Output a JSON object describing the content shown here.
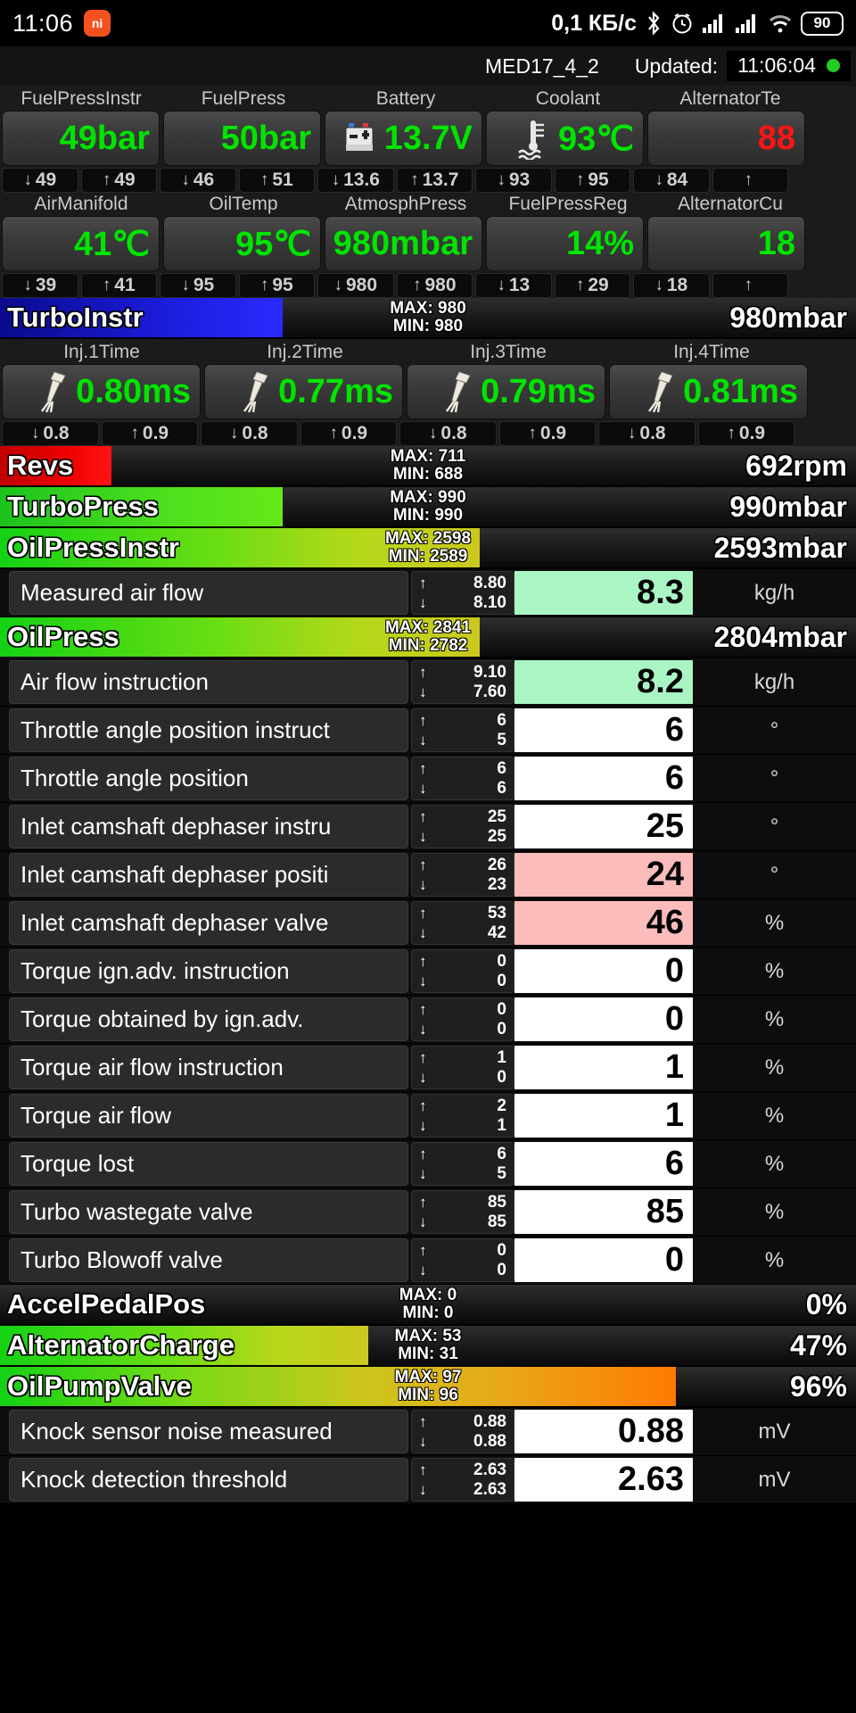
{
  "statusbar": {
    "time": "11:06",
    "app_badge": "ni",
    "net_speed": "0,1 КБ/с",
    "bluetooth_icon": "bluetooth-icon",
    "alarm_icon": "alarm-icon",
    "signal1_icon": "signal-bars-icon",
    "signal2_icon": "signal-bars-icon",
    "wifi_icon": "wifi-icon",
    "battery_level": "90"
  },
  "header": {
    "ecu": "MED17_4_2",
    "updated_label": "Updated:",
    "updated_time": "11:06:04",
    "status_dot_color": "#22cc22"
  },
  "gauges_row1": {
    "items": [
      {
        "title": "FuelPressInstr",
        "value": "49bar",
        "color": "green",
        "icon": "",
        "min": "49",
        "max": "49"
      },
      {
        "title": "FuelPress",
        "value": "50bar",
        "color": "green",
        "icon": "",
        "min": "46",
        "max": "51"
      },
      {
        "title": "Battery",
        "value": "13.7V",
        "color": "green",
        "icon": "battery-icon",
        "min": "13.6",
        "max": "13.7"
      },
      {
        "title": "Coolant",
        "value": "93℃",
        "color": "green",
        "icon": "thermometer-icon",
        "min": "93",
        "max": "95"
      },
      {
        "title": "AlternatorTe",
        "value": "88",
        "color": "red",
        "icon": "",
        "min": "84",
        "max": ""
      }
    ]
  },
  "gauges_row2": {
    "items": [
      {
        "title": "AirManifold",
        "value": "41℃",
        "color": "green",
        "icon": "",
        "min": "39",
        "max": "41"
      },
      {
        "title": "OilTemp",
        "value": "95℃",
        "color": "green",
        "icon": "",
        "min": "95",
        "max": "95"
      },
      {
        "title": "AtmosphPress",
        "value": "980mbar",
        "color": "green",
        "icon": "",
        "min": "980",
        "max": "980"
      },
      {
        "title": "FuelPressReg",
        "value": "14%",
        "color": "green",
        "icon": "",
        "min": "13",
        "max": "29"
      },
      {
        "title": "AlternatorCu",
        "value": "18",
        "color": "green",
        "icon": "",
        "min": "18",
        "max": ""
      }
    ]
  },
  "gauges_inj": {
    "items": [
      {
        "title": "Inj.1Time",
        "value": "0.80ms",
        "color": "green",
        "icon": "injector-icon",
        "min": "0.8",
        "max": "0.9"
      },
      {
        "title": "Inj.2Time",
        "value": "0.77ms",
        "color": "green",
        "icon": "injector-icon",
        "min": "0.8",
        "max": "0.9"
      },
      {
        "title": "Inj.3Time",
        "value": "0.79ms",
        "color": "green",
        "icon": "injector-icon",
        "min": "0.8",
        "max": "0.9"
      },
      {
        "title": "Inj.4Time",
        "value": "0.81ms",
        "color": "green",
        "icon": "injector-icon",
        "min": "0.8",
        "max": "0.9"
      }
    ]
  },
  "bars": {
    "turbo_instr": {
      "name": "TurboInstr",
      "max_label": "MAX: 980",
      "min_label": "MIN: 980",
      "value": "980mbar",
      "fill_pct": 33,
      "fill": "blue"
    },
    "revs": {
      "name": "Revs",
      "max_label": "MAX: 711",
      "min_label": "MIN: 688",
      "value": "692rpm",
      "fill_pct": 13,
      "fill": "red"
    },
    "turbo_press": {
      "name": "TurboPress",
      "max_label": "MAX: 990",
      "min_label": "MIN: 990",
      "value": "990mbar",
      "fill_pct": 33,
      "fill": "green"
    },
    "oil_press_instr": {
      "name": "OilPressInstr",
      "max_label": "MAX: 2598",
      "min_label": "MIN: 2589",
      "value": "2593mbar",
      "fill_pct": 56,
      "fill": "greenyellow"
    },
    "oil_press": {
      "name": "OilPress",
      "max_label": "MAX: 2841",
      "min_label": "MIN: 2782",
      "value": "2804mbar",
      "fill_pct": 56,
      "fill": "greenyellow"
    },
    "accel_pedal_pos": {
      "name": "AccelPedalPos",
      "max_label": "MAX: 0",
      "min_label": "MIN: 0",
      "value": "0%",
      "fill_pct": 0,
      "fill": "green"
    },
    "alternator_charge": {
      "name": "AlternatorCharge",
      "max_label": "MAX: 53",
      "min_label": "MIN: 31",
      "value": "47%",
      "fill_pct": 43,
      "fill": "greenyellow"
    },
    "oil_pump_valve": {
      "name": "OilPumpValve",
      "max_label": "MAX: 97",
      "min_label": "MIN: 96",
      "value": "96%",
      "fill_pct": 79,
      "fill": "greenorange"
    }
  },
  "datarows": [
    {
      "label": "Measured air flow",
      "max": "8.80",
      "min": "8.10",
      "value": "8.3",
      "unit": "kg/h",
      "bg": "green"
    },
    {
      "label": "Air flow instruction",
      "max": "9.10",
      "min": "7.60",
      "value": "8.2",
      "unit": "kg/h",
      "bg": "green"
    },
    {
      "label": "Throttle angle position instruct",
      "max": "6",
      "min": "5",
      "value": "6",
      "unit": "°",
      "bg": "white"
    },
    {
      "label": "Throttle angle position",
      "max": "6",
      "min": "6",
      "value": "6",
      "unit": "°",
      "bg": "white"
    },
    {
      "label": "Inlet camshaft dephaser instru",
      "max": "25",
      "min": "25",
      "value": "25",
      "unit": "°",
      "bg": "white"
    },
    {
      "label": "Inlet camshaft dephaser positi",
      "max": "26",
      "min": "23",
      "value": "24",
      "unit": "°",
      "bg": "pink"
    },
    {
      "label": "Inlet camshaft dephaser valve",
      "max": "53",
      "min": "42",
      "value": "46",
      "unit": "%",
      "bg": "pink"
    },
    {
      "label": "Torque ign.adv. instruction",
      "max": "0",
      "min": "0",
      "value": "0",
      "unit": "%",
      "bg": "white"
    },
    {
      "label": "Torque obtained by ign.adv.",
      "max": "0",
      "min": "0",
      "value": "0",
      "unit": "%",
      "bg": "white"
    },
    {
      "label": "Torque air flow instruction",
      "max": "1",
      "min": "0",
      "value": "1",
      "unit": "%",
      "bg": "white"
    },
    {
      "label": "Torque air flow",
      "max": "2",
      "min": "1",
      "value": "1",
      "unit": "%",
      "bg": "white"
    },
    {
      "label": "Torque lost",
      "max": "6",
      "min": "5",
      "value": "6",
      "unit": "%",
      "bg": "white"
    },
    {
      "label": "Turbo wastegate valve",
      "max": "85",
      "min": "85",
      "value": "85",
      "unit": "%",
      "bg": "white"
    },
    {
      "label": "Turbo Blowoff valve",
      "max": "0",
      "min": "0",
      "value": "0",
      "unit": "%",
      "bg": "white"
    }
  ],
  "datarows_bottom": [
    {
      "label": "Knock sensor noise measured",
      "max": "0.88",
      "min": "0.88",
      "value": "0.88",
      "unit": "mV",
      "bg": "white"
    },
    {
      "label": "Knock detection threshold",
      "max": "2.63",
      "min": "2.63",
      "value": "2.63",
      "unit": "mV",
      "bg": "white"
    }
  ],
  "colors": {
    "green_text": "#00e400",
    "red_text": "#ff1414",
    "accent_blue": "#1414e6",
    "accent_red": "#e60000",
    "accent_green": "#33dd11",
    "highlight_green": "#aaf5c4",
    "highlight_pink": "#fcbcbc"
  }
}
